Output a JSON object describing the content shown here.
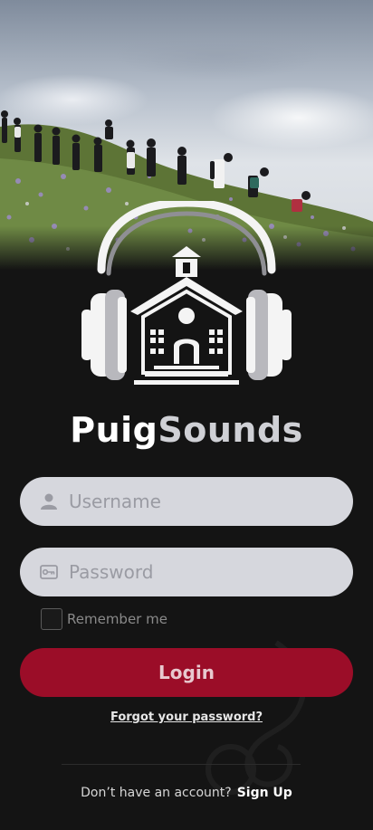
{
  "app": {
    "brand_part1": "Puig",
    "brand_part2": "Sounds"
  },
  "form": {
    "username_placeholder": "Username",
    "password_placeholder": "Password",
    "remember_label": "Remember me",
    "login_label": "Login",
    "forgot_label": "Forgot your password?"
  },
  "footer": {
    "signup_question": "Don’t have an account?",
    "signup_link": "Sign Up"
  },
  "icons": {
    "username": "user-icon",
    "password": "key-card-icon"
  },
  "colors": {
    "background": "#141414",
    "field": "#d6d7dd",
    "accent": "#9b0d28",
    "brand_secondary": "#cfd0d5"
  }
}
